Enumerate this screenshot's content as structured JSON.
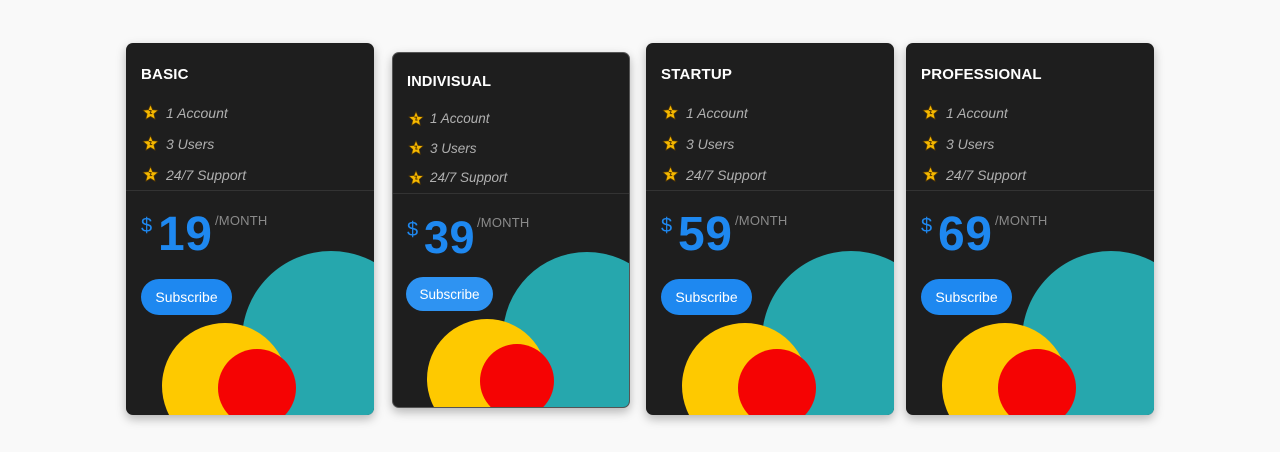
{
  "cards": [
    {
      "title": "BASIC",
      "features": [
        "1 Account",
        "3 Users",
        "24/7 Support"
      ],
      "currency": "$",
      "price": "19",
      "period": "/MONTH",
      "subscribe_label": "Subscribe"
    },
    {
      "title": "INDIVISUAL",
      "features": [
        "1 Account",
        "3 Users",
        "24/7 Support"
      ],
      "currency": "$",
      "price": "39",
      "period": "/MONTH",
      "subscribe_label": "Subscribe"
    },
    {
      "title": "STARTUP",
      "features": [
        "1 Account",
        "3 Users",
        "24/7 Support"
      ],
      "currency": "$",
      "price": "59",
      "period": "/MONTH",
      "subscribe_label": "Subscribe"
    },
    {
      "title": "PROFESSIONAL",
      "features": [
        "1 Account",
        "3 Users",
        "24/7 Support"
      ],
      "currency": "$",
      "price": "69",
      "period": "/MONTH",
      "subscribe_label": "Subscribe"
    }
  ],
  "icons": {
    "feature": "star-icon"
  },
  "colors": {
    "page_background": "#f9f9f9",
    "card_background": "#1e1e1e",
    "accent_blue": "#1e88f0",
    "star": "#f5b800",
    "teal": "#26a7ad",
    "yellow": "#fec900",
    "red": "#f50303"
  }
}
